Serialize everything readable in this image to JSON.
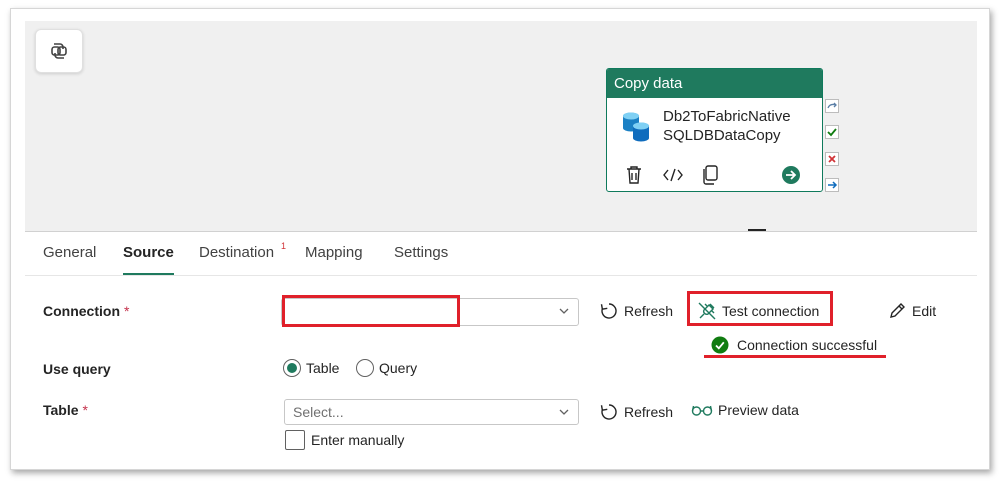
{
  "activity": {
    "title": "Copy data",
    "name_line1": "Db2ToFabricNative",
    "name_line2": "SQLDBDataCopy"
  },
  "tabs": [
    {
      "label": "General",
      "active": false
    },
    {
      "label": "Source",
      "active": true
    },
    {
      "label": "Destination",
      "active": false,
      "badge": "1"
    },
    {
      "label": "Mapping",
      "active": false
    },
    {
      "label": "Settings",
      "active": false
    }
  ],
  "connection": {
    "label": "Connection",
    "required_mark": "*",
    "value": "",
    "refresh_label": "Refresh",
    "test_label": "Test connection",
    "edit_label": "Edit",
    "status_text": "Connection successful"
  },
  "use_query": {
    "label": "Use query",
    "options": [
      "Table",
      "Query"
    ],
    "selected": "Table"
  },
  "table": {
    "label": "Table",
    "required_mark": "*",
    "placeholder": "Select...",
    "refresh_label": "Refresh",
    "preview_label": "Preview data",
    "enter_manually_label": "Enter manually"
  },
  "colors": {
    "accent": "#1f7a5e",
    "highlight_red": "#e0202a",
    "success_green": "#107c10",
    "required_red": "#c4314b"
  }
}
